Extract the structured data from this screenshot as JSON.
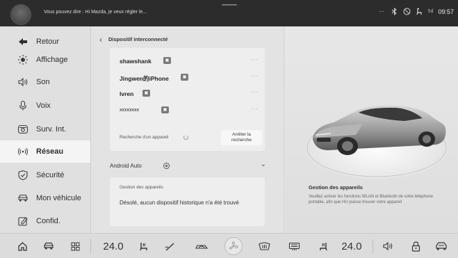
{
  "status_bar": {
    "voice_hint": "Vous pouvez dire : Hi Mazda, je veux régler le...",
    "signal": "5d",
    "time": "09:57",
    "icons": [
      "more-icon",
      "bluetooth-icon",
      "no-sound-icon",
      "seat-icon",
      "signal-icon"
    ]
  },
  "sidebar": {
    "back_label": "Retour",
    "items": [
      {
        "label": "Affichage",
        "icon": "brightness-icon"
      },
      {
        "label": "Son",
        "icon": "speaker-icon"
      },
      {
        "label": "Voix",
        "icon": "microphone-icon"
      },
      {
        "label": "Surv. Int.",
        "icon": "camera-icon"
      },
      {
        "label": "Réseau",
        "icon": "wireless-icon",
        "active": true
      },
      {
        "label": "Sécurité",
        "icon": "shield-icon"
      },
      {
        "label": "Mon véhicule",
        "icon": "vehicle-icon"
      },
      {
        "label": "Confid.",
        "icon": "privacy-icon"
      }
    ]
  },
  "middle": {
    "title": "Dispositif interconnecté",
    "devices": [
      {
        "name": "shawshank",
        "more": "···"
      },
      {
        "name": "Jingwen的iPhone",
        "more": "···"
      },
      {
        "name": "lvren",
        "more": "···"
      },
      {
        "name": "xxxxxxxx",
        "more": "···"
      }
    ],
    "search_label": "Recherche d'un appareil",
    "stop_button": "Arrêter la recherche",
    "android_auto_label": "Android Auto",
    "history_title": "Gestion des appareils",
    "history_message": "Désolé, aucun dispositif historique n'a été trouvé"
  },
  "right": {
    "title": "Gestion des appareils",
    "description": "Veuillez activer les fonctions WLAN et Bluetooth de votre téléphone portable, afin que HU puisse trouver votre appareil"
  },
  "dock": {
    "left_temp": "24.0",
    "right_temp": "24.0",
    "icons": [
      "home-icon",
      "car-icon",
      "apps-grid-icon",
      "seat-heat-left-icon",
      "wiper-icon",
      "recirculation-icon",
      "fan-icon",
      "front-defrost-icon",
      "rear-defrost-icon",
      "seat-heat-right-icon",
      "volume-icon",
      "lock-icon",
      "car-rear-icon"
    ]
  },
  "colors": {
    "status_bar_bg": "#2c2c2c",
    "screen_bg": "#e3e3e3",
    "active_item_bg": "#f4f4f4",
    "card_bg": "#eeeeee"
  }
}
